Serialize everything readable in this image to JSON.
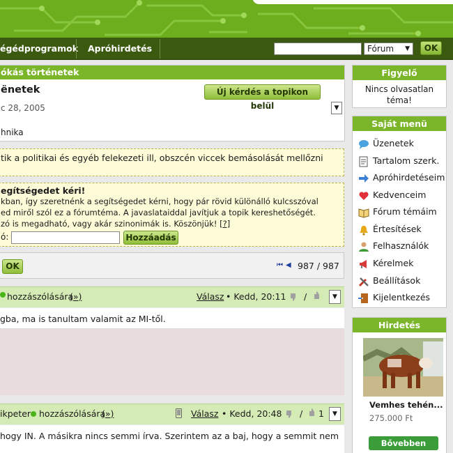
{
  "nav": {
    "items": [
      "égédprogramok",
      "Apróhirdetés"
    ],
    "search_placeholder": "",
    "search_select": "Fórum",
    "ok": "OK"
  },
  "topic": {
    "section_title": "ókás történetek",
    "title": "ënetek",
    "new_question": "Új kérdés a topikon belül",
    "date": "c 28, 2005",
    "category": "hnika",
    "rule_notice": "tik a politikai és egyéb felekezeti ill, obszcén viccek bemásolását mellőzni",
    "help": {
      "title": "egítségedet kéri!",
      "line1": "kban, így szeretnénk a segítségedet kérni, hogy pár rövid különálló kulcsszóval",
      "line2": "ed miről szól ez a fórumtéma. A javaslataiddal javítjuk a topik kereshetőségét.",
      "line3": "zó is megadható, vagy akár szinonimák is. Köszönjük!",
      "help_link": "[?]",
      "field_label": "ó:",
      "add_button": "Hozzáadás"
    },
    "ok": "OK",
    "pager": "987 / 987"
  },
  "posts": [
    {
      "author": "",
      "reply_to": "hozzászólására",
      "reply_arrow": "(»)",
      "reply": "Válasz",
      "time": "Kedd, 20:11",
      "like_count": "",
      "body": "gba, ma is tanultam valamit az MI-től."
    },
    {
      "author": "ikpeter",
      "reply_to": "hozzászólására",
      "reply_arrow": "(»)",
      "reply": "Válasz",
      "time": "Kedd, 20:48",
      "like_count": "1",
      "body": "hogy IN. A másikra nincs semmi írva. Szerintem az a baj, hogy a semmit nem"
    }
  ],
  "sidebar": {
    "watch": {
      "title": "Figyelő",
      "text": "Nincs olvasatlan téma!"
    },
    "menu": {
      "title": "Saját menü",
      "items": [
        {
          "label": "Üzenetek",
          "icon": "message-bubble-icon"
        },
        {
          "label": "Tartalom szerk.",
          "icon": "document-icon"
        },
        {
          "label": "Apróhirdetéseim",
          "icon": "arrow-right-icon"
        },
        {
          "label": "Kedvenceim",
          "icon": "heart-icon"
        },
        {
          "label": "Fórum témáim",
          "icon": "book-icon"
        },
        {
          "label": "Értesítések",
          "icon": "bell-icon"
        },
        {
          "label": "Felhasználók",
          "icon": "user-icon"
        },
        {
          "label": "Kérelmek",
          "icon": "megaphone-icon"
        },
        {
          "label": "Beállítások",
          "icon": "tools-icon"
        },
        {
          "label": "Kijelentkezés",
          "icon": "logout-door-icon"
        }
      ]
    },
    "ad": {
      "title": "Hirdetés",
      "item_title": "Vemhes tehén...",
      "price": "275.000 Ft",
      "button": "Bővebben"
    }
  },
  "colors": {
    "accent_green": "#7bb52a",
    "nav_dark": "#3b5a10",
    "light_green": "#d5ebb5",
    "notice_yellow": "#fefcd8"
  }
}
